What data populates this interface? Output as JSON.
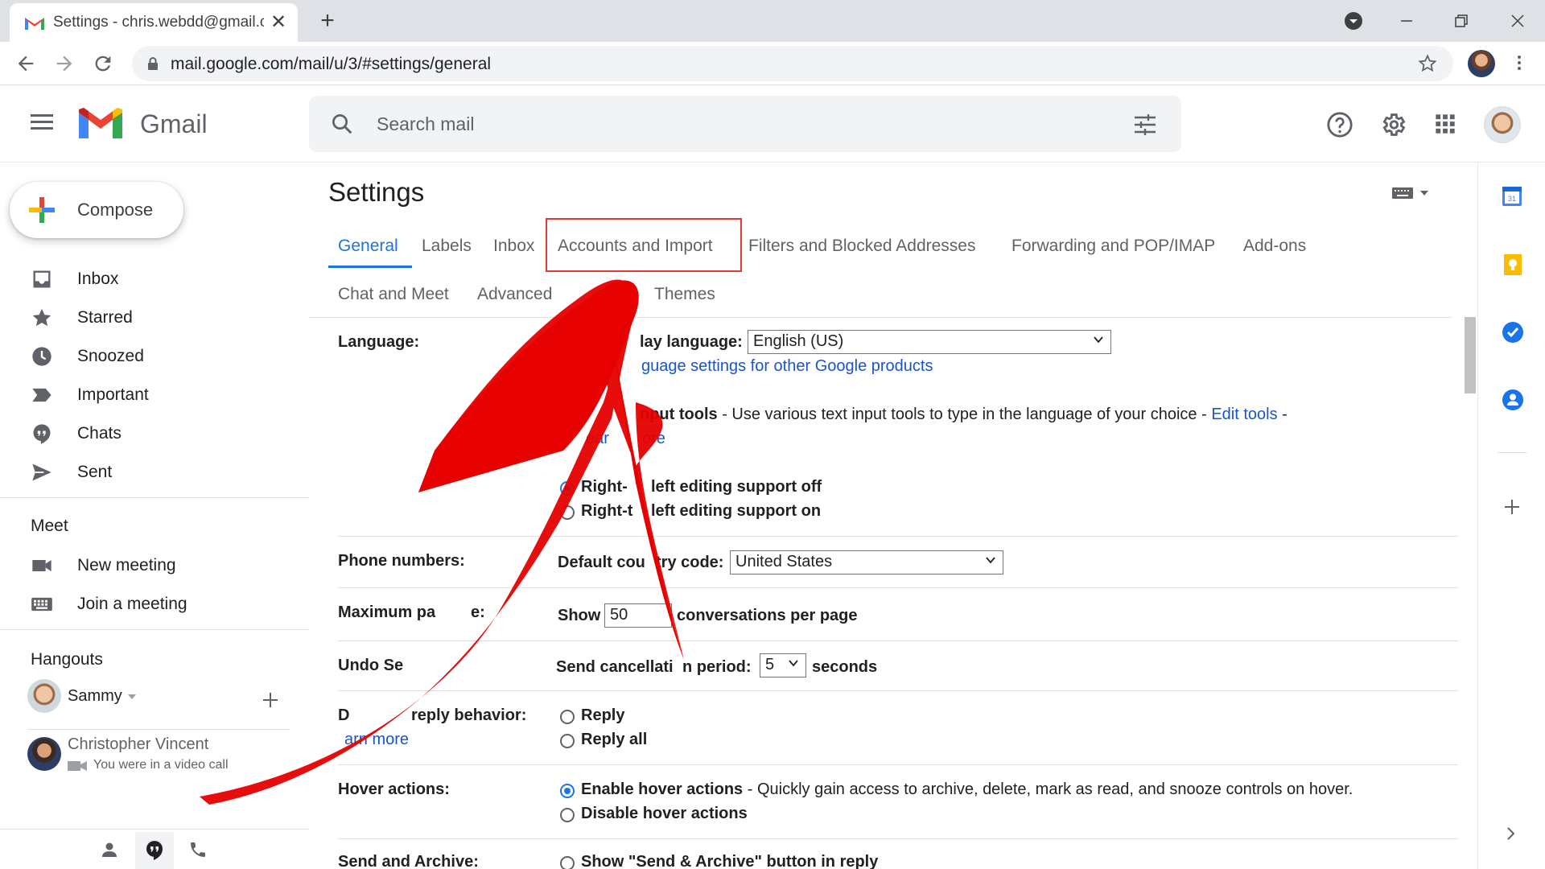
{
  "browser": {
    "tab_title": "Settings - chris.webdd@gmail.com",
    "tab_close": "✕",
    "new_tab": "+",
    "url": "mail.google.com/mail/u/3/#settings/general"
  },
  "header": {
    "app_name": "Gmail",
    "search_placeholder": "Search mail"
  },
  "sidebar": {
    "compose_label": "Compose",
    "items": [
      {
        "label": "Inbox",
        "icon": "inbox-icon"
      },
      {
        "label": "Starred",
        "icon": "star-icon"
      },
      {
        "label": "Snoozed",
        "icon": "clock-icon"
      },
      {
        "label": "Important",
        "icon": "important-icon"
      },
      {
        "label": "Chats",
        "icon": "chat-icon"
      },
      {
        "label": "Sent",
        "icon": "send-icon"
      }
    ],
    "meet": {
      "heading": "Meet",
      "new_meeting": "New meeting",
      "join_meeting": "Join a meeting"
    },
    "hangouts": {
      "heading": "Hangouts",
      "user": "Sammy",
      "contact_name": "Christopher Vincent",
      "contact_status": "You were in a video call"
    }
  },
  "settings": {
    "title": "Settings",
    "tabs": {
      "general": "General",
      "labels": "Labels",
      "inbox": "Inbox",
      "accounts": "Accounts and Import",
      "filters": "Filters and Blocked Addresses",
      "forwarding": "Forwarding and POP/IMAP",
      "addons": "Add-ons",
      "chat": "Chat and Meet",
      "advanced": "Advanced",
      "themes": "Themes"
    },
    "language": {
      "label": "Language:",
      "display_label": "lay language:",
      "display_value": "English (US)",
      "other_products_link": "guage settings for other Google products",
      "input_tools_bold": "nput tools",
      "input_tools_text": " - Use various text input tools to type in the language of your choice - ",
      "edit_tools": "Edit tools",
      "dash": " -",
      "learn_more_partial": "ear",
      "learn_more_partial2": "ore",
      "rtl_off": "Right-",
      "rtl_off_rest": "left editing support off",
      "rtl_on": "Right-t",
      "rtl_on_rest": "left editing support on"
    },
    "phone": {
      "label": "Phone numbers:",
      "country_label_a": "Default cou",
      "country_label_b": "try code:",
      "country_value": "United States"
    },
    "page_size": {
      "label_a": "Maximum pa",
      "label_b": "e:",
      "show": "Show",
      "value": "50",
      "suffix": "conversations per page"
    },
    "undo_send": {
      "label": "Undo Se",
      "period_label_a": "Send cancellati",
      "period_label_b": "n period:",
      "value": "5",
      "suffix": "seconds"
    },
    "reply": {
      "label_a": "D",
      "label_b": " reply behavior:",
      "learn_more": "arn more",
      "reply": "Reply",
      "reply_all": "Reply all"
    },
    "hover": {
      "label": "Hover actions:",
      "enable_bold": "Enable hover actions",
      "enable_text": " - Quickly gain access to archive, delete, mark as read, and snooze controls on hover.",
      "disable": "Disable hover actions"
    },
    "send_archive": {
      "label": "Send and Archive:",
      "option": "Show \"Send & Archive\" button in reply"
    }
  },
  "colors": {
    "accent_blue": "#1a73e8",
    "arrow_red": "#e60000",
    "highlight_red": "#e53935"
  }
}
